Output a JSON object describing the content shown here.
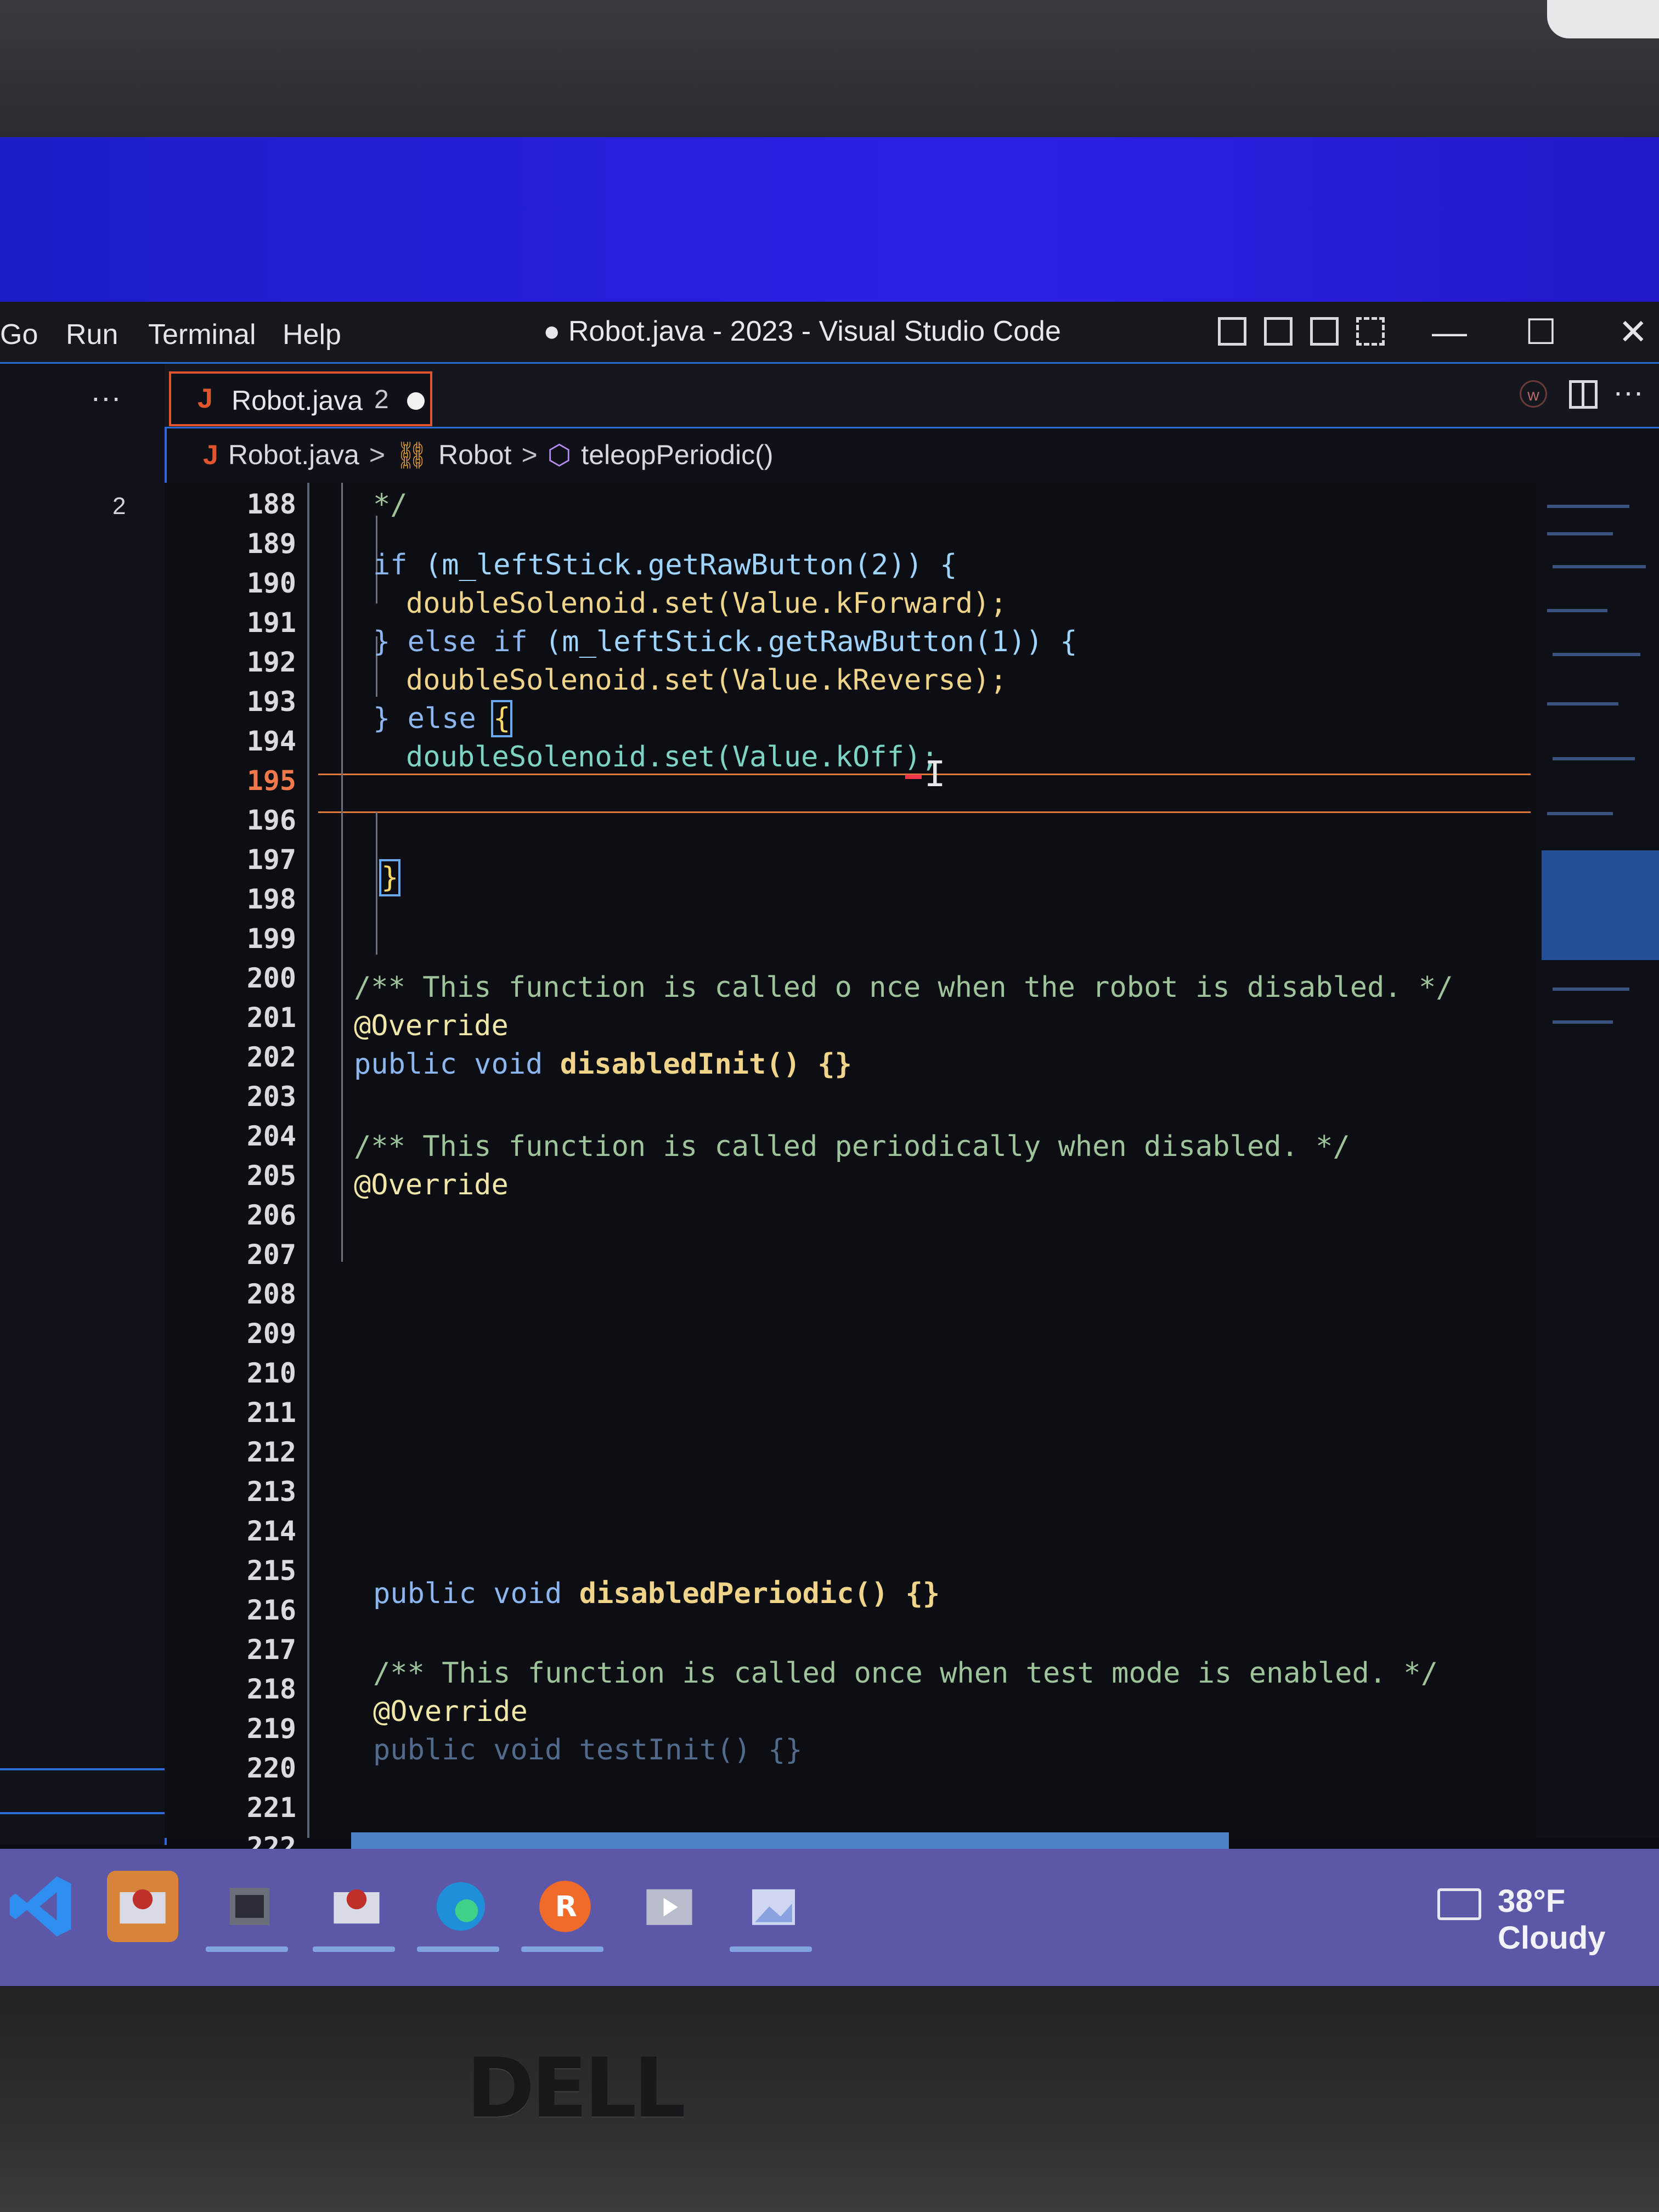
{
  "window": {
    "title": "● Robot.java - 2023 - Visual Studio Code",
    "menu": [
      "Go",
      "Run",
      "Terminal",
      "Help"
    ],
    "controls": {
      "minimize": "—",
      "maximize": "☐",
      "close": "✕"
    }
  },
  "sidebar": {
    "more": "···",
    "badge_count": "2"
  },
  "tab": {
    "icon": "J",
    "name": "Robot.java",
    "problem_count": "2",
    "unsaved": true
  },
  "editor_actions": {
    "badge": "w",
    "more": "···"
  },
  "breadcrumb": {
    "file_icon": "J",
    "file": "Robot.java",
    "sep": ">",
    "class": "Robot",
    "method": "teleopPeriodic()"
  },
  "editor": {
    "active_line": "195",
    "line_numbers": [
      "188",
      "189",
      "190",
      "191",
      "192",
      "193",
      "194",
      "195",
      "196",
      "197",
      "198",
      "199",
      "200",
      "201",
      "202",
      "203",
      "204",
      "205",
      "206",
      "207",
      "208",
      "209",
      "210",
      "211",
      "212",
      "213",
      "214",
      "215",
      "216",
      "217",
      "218",
      "219",
      "220",
      "221",
      "222"
    ],
    "code": {
      "l188": "*/",
      "l190_if": "if",
      "l190_rest": "(m_leftStick.getRawButton(2)) {",
      "l191": "doubleSolenoid.set(Value.kForward);",
      "l192_else": "} else if",
      "l192_rest": "(m_leftStick.getRawButton(1)) {",
      "l193": "doubleSolenoid.set(Value.kReverse);",
      "l194_else": "} else",
      "l194_brace": "{",
      "l195": "doubleSolenoid.set(Value.kOff);",
      "l198": "}",
      "l201": "/** This function is called o nce when the robot is disabled. */",
      "l202": "@Override",
      "l203_kw": "public void",
      "l203_fn": "disabledInit() {}",
      "l205": "/** This function is called periodically when disabled. */",
      "l206": "@Override",
      "l218_kw": "public void",
      "l218_fn": "disabledPeriodic() {}",
      "l220": "/** This function is called once when test mode is enabled. */",
      "l221": "@Override",
      "l222": "public void testInit() {}"
    }
  },
  "taskbar": {
    "apps": [
      "vscode-icon",
      "frc-driver-station-icon",
      "film-icon",
      "frc-app-icon",
      "edge-icon",
      "rev-hardware-client-icon",
      "media-player-icon",
      "photos-icon"
    ],
    "weather": "38°F Cloudy"
  },
  "colors": {
    "accent": "#2a6bd6",
    "active_line_number": "#f0784a",
    "tab_border": "#e0552e",
    "taskbar": "#5d57a8"
  },
  "hardware": {
    "logo": "DELL"
  }
}
